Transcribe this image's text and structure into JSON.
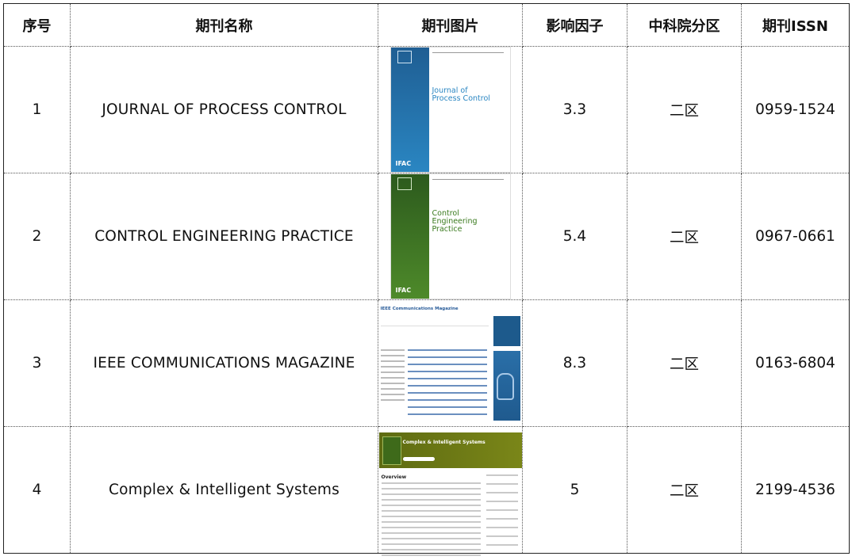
{
  "headers": {
    "index": "序号",
    "name": "期刊名称",
    "image": "期刊图片",
    "impact": "影响因子",
    "zone": "中科院分区",
    "issn": "期刊ISSN"
  },
  "rows": [
    {
      "index": "1",
      "name": "JOURNAL OF PROCESS CONTROL",
      "impact": "3.3",
      "zone": "二区",
      "issn": "0959-1524",
      "cover_title_line1": "Journal of",
      "cover_title_line2": "Process Control",
      "cover_badge": "IFAC",
      "cover_color": "#2a86c2"
    },
    {
      "index": "2",
      "name": "CONTROL ENGINEERING PRACTICE",
      "impact": "5.4",
      "zone": "二区",
      "issn": "0967-0661",
      "cover_title_line1": "Control",
      "cover_title_line2": "Engineering",
      "cover_title_line3": "Practice",
      "cover_badge": "IFAC",
      "cover_color": "#4e8a2a"
    },
    {
      "index": "3",
      "name": "IEEE COMMUNICATIONS MAGAZINE",
      "impact": "8.3",
      "zone": "二区",
      "issn": "0163-6804",
      "cover_title_line1": "IEEE Communications Magazine",
      "cover_color": "#1d5a8c"
    },
    {
      "index": "4",
      "name": "Complex & Intelligent Systems",
      "impact": "5",
      "zone": "二区",
      "issn": "2199-4536",
      "cover_title_line1": "Complex & Intelligent Systems",
      "cover_overview": "Overview",
      "cover_color": "#6f7b15"
    }
  ]
}
